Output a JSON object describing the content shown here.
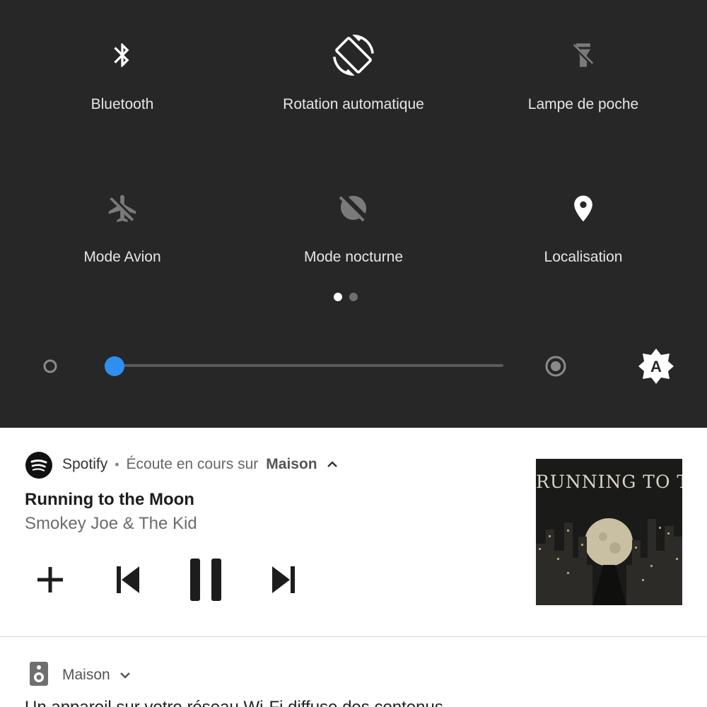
{
  "quick_settings": {
    "tiles": [
      {
        "label": "Bluetooth",
        "icon": "bluetooth-icon",
        "state": "on"
      },
      {
        "label": "Rotation automatique",
        "icon": "screen-rotation-icon",
        "state": "on"
      },
      {
        "label": "Lampe de poche",
        "icon": "flashlight-icon",
        "state": "off"
      },
      {
        "label": "Mode Avion",
        "icon": "airplane-off-icon",
        "state": "off"
      },
      {
        "label": "Mode nocturne",
        "icon": "night-mode-off-icon",
        "state": "off"
      },
      {
        "label": "Localisation",
        "icon": "location-pin-icon",
        "state": "on"
      }
    ],
    "page_count": 2,
    "current_page": 1,
    "brightness": {
      "level": 0.0,
      "auto_label": "A"
    },
    "colors": {
      "panel_bg": "#272727",
      "accent": "#2e8ff0",
      "on_icon": "#ffffff",
      "off_icon": "#7a7a7a"
    }
  },
  "media_notification": {
    "app_name": "Spotify",
    "separator": "•",
    "subtext": "Écoute en cours sur",
    "device": "Maison",
    "song_title": "Running to the Moon",
    "artist": "Smokey Joe & The Kid",
    "controls": [
      "add-icon",
      "skip-previous-icon",
      "pause-icon",
      "skip-next-icon"
    ],
    "album_art": {
      "title": "RUNNING TO THE MOON"
    }
  },
  "cast_notification": {
    "app_name": "Maison",
    "icon": "speaker-icon",
    "body": "Un appareil sur votre réseau Wi-Fi diffuse des contenus"
  }
}
